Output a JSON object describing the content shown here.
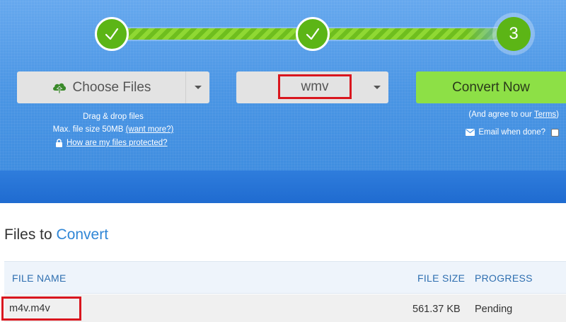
{
  "steps": [
    {
      "state": "done"
    },
    {
      "state": "done"
    },
    {
      "state": "current",
      "label": "3"
    }
  ],
  "choose_files": {
    "label": "Choose Files",
    "icon": "cloud-upload-icon"
  },
  "format": {
    "value": "wmv"
  },
  "convert": {
    "label": "Convert Now"
  },
  "upload_info": {
    "drag_drop": "Drag & drop files",
    "max_size": "Max. file size 50MB",
    "want_more": "(want more?)",
    "protected_link": "How are my files protected?"
  },
  "terms": {
    "prefix": "(And agree to our ",
    "link": "Terms",
    "suffix": ")"
  },
  "email": {
    "label": "Email when done?"
  },
  "files": {
    "title_prefix": "Files to",
    "title_accent": "Convert",
    "columns": {
      "name": "FILE NAME",
      "size": "FILE SIZE",
      "progress": "PROGRESS"
    },
    "rows": [
      {
        "name": "m4v.m4v",
        "size": "561.37 KB",
        "progress": "Pending"
      }
    ]
  },
  "colors": {
    "hero_blue": "#4a95e4",
    "step_green": "#5cb516",
    "convert_green": "#8de046",
    "highlight_red": "#d9161e",
    "accent_blue": "#2f86d6"
  }
}
